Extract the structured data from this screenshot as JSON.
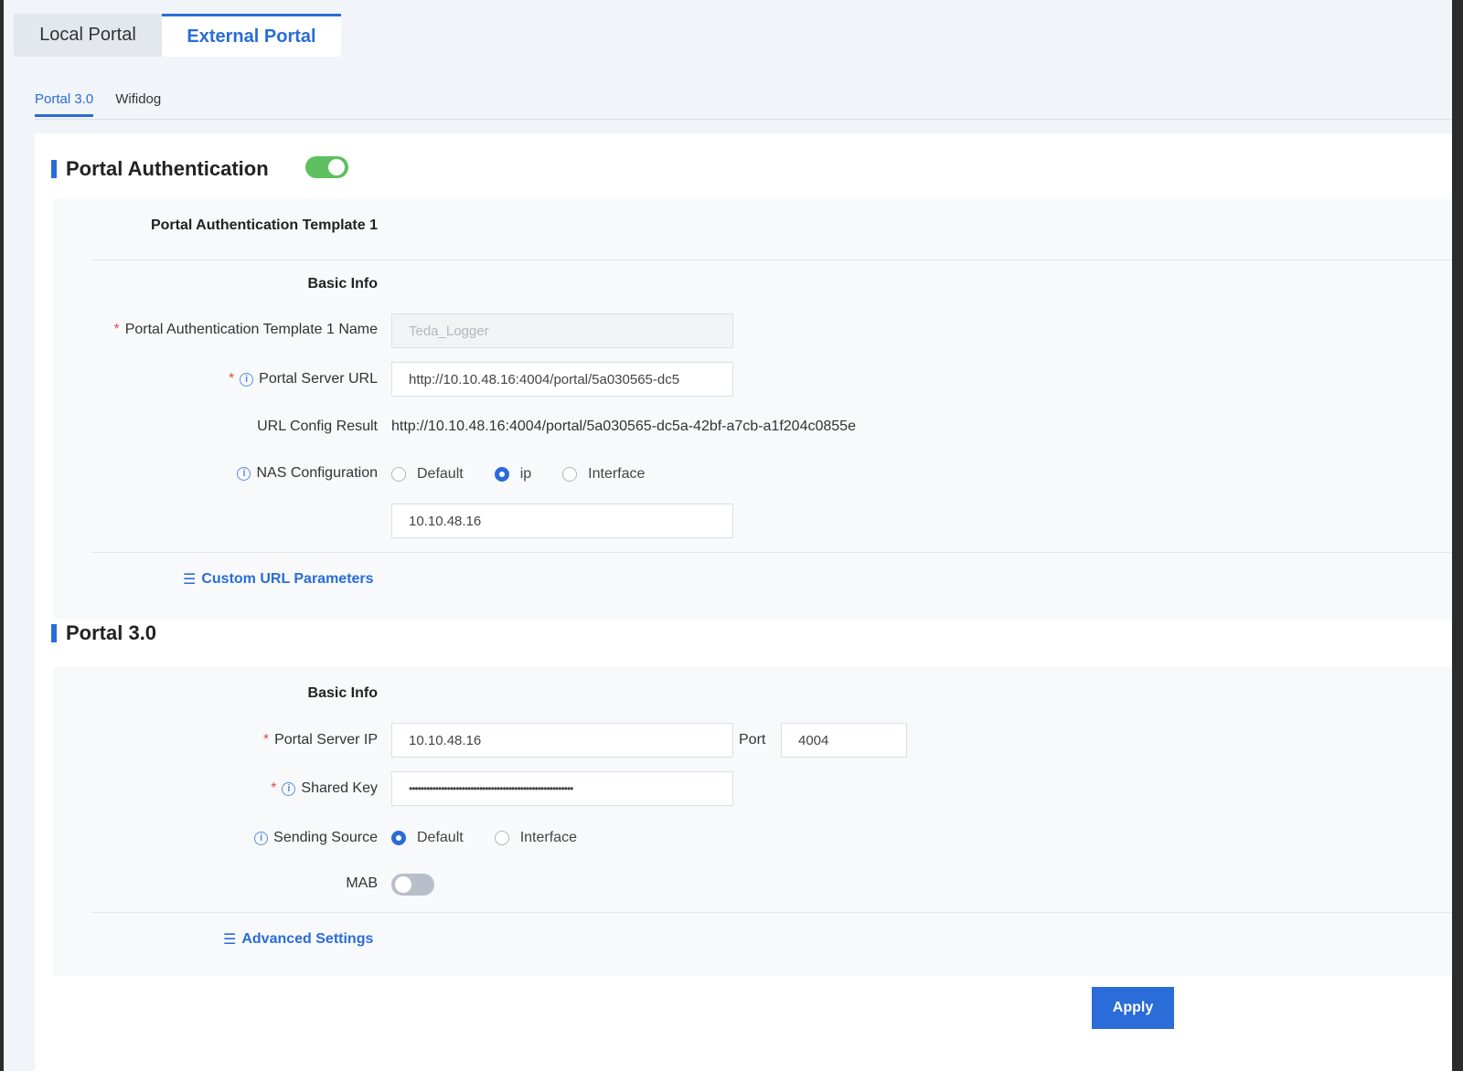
{
  "top_tabs": [
    {
      "label": "Local Portal"
    },
    {
      "label": "External Portal"
    }
  ],
  "sub_tabs": [
    {
      "label": "Portal 3.0"
    },
    {
      "label": "Wifidog"
    }
  ],
  "portal_auth": {
    "title": "Portal Authentication",
    "enabled": true,
    "template_title": "Portal Authentication Template 1",
    "basic_info": "Basic Info",
    "name_label": "Portal Authentication Template 1 Name",
    "name_value": "Teda_Logger",
    "url_label": "Portal Server URL",
    "url_value": "http://10.10.48.16:4004/portal/5a030565-dc5",
    "config_result_label": "URL Config Result",
    "config_result_value": "http://10.10.48.16:4004/portal/5a030565-dc5a-42bf-a7cb-a1f204c0855e",
    "nas_label": "NAS Configuration",
    "nas_options": [
      "Default",
      "ip",
      "Interface"
    ],
    "nas_selected": "ip",
    "nas_ip_value": "10.10.48.16",
    "custom_params_link": "Custom URL Parameters"
  },
  "portal30": {
    "title": "Portal 3.0",
    "basic_info": "Basic Info",
    "server_ip_label": "Portal Server IP",
    "server_ip_value": "10.10.48.16",
    "port_label": "Port",
    "port_value": "4004",
    "shared_key_label": "Shared Key",
    "shared_key_value": "••••••••••••••••••••••••••••••••••••••••••••••••••••••••",
    "sending_source_label": "Sending Source",
    "sending_options": [
      "Default",
      "Interface"
    ],
    "sending_selected": "Default",
    "mab_label": "MAB",
    "mab_enabled": false,
    "advanced_link": "Advanced Settings"
  },
  "apply_label": "Apply",
  "colors": {
    "accent": "#2a6cd8",
    "toggle_on": "#5dbf5f",
    "toggle_off": "#b9bfc9",
    "required": "#e24d4d"
  }
}
